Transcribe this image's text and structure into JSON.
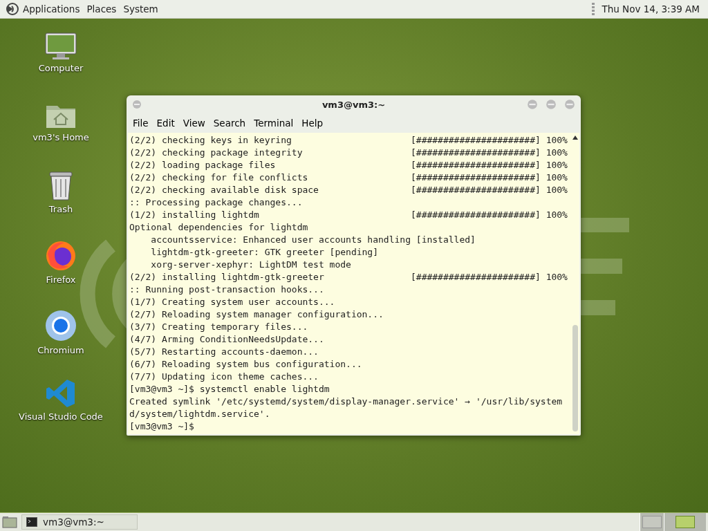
{
  "top_panel": {
    "menus": [
      "Applications",
      "Places",
      "System"
    ],
    "clock": "Thu Nov 14,  3:39 AM"
  },
  "desktop_icons": [
    {
      "kind": "computer",
      "label": "Computer"
    },
    {
      "kind": "home",
      "label": "vm3's Home"
    },
    {
      "kind": "trash",
      "label": "Trash"
    },
    {
      "kind": "firefox",
      "label": "Firefox"
    },
    {
      "kind": "chromium",
      "label": "Chromium"
    },
    {
      "kind": "vscode",
      "label": "Visual Studio Code"
    }
  ],
  "terminal": {
    "title": "vm3@vm3:~",
    "menus": [
      "File",
      "Edit",
      "View",
      "Search",
      "Terminal",
      "Help"
    ],
    "lines": [
      {
        "text": "(2/2) checking keys in keyring",
        "bar": "[######################]",
        "percent": "100%"
      },
      {
        "text": "(2/2) checking package integrity",
        "bar": "[######################]",
        "percent": "100%"
      },
      {
        "text": "(2/2) loading package files",
        "bar": "[######################]",
        "percent": "100%"
      },
      {
        "text": "(2/2) checking for file conflicts",
        "bar": "[######################]",
        "percent": "100%"
      },
      {
        "text": "(2/2) checking available disk space",
        "bar": "[######################]",
        "percent": "100%"
      },
      {
        "text": ":: Processing package changes..."
      },
      {
        "text": "(1/2) installing lightdm",
        "bar": "[######################]",
        "percent": "100%"
      },
      {
        "text": "Optional dependencies for lightdm"
      },
      {
        "text": "    accountsservice: Enhanced user accounts handling [installed]"
      },
      {
        "text": "    lightdm-gtk-greeter: GTK greeter [pending]"
      },
      {
        "text": "    xorg-server-xephyr: LightDM test mode"
      },
      {
        "text": "(2/2) installing lightdm-gtk-greeter",
        "bar": "[######################]",
        "percent": "100%"
      },
      {
        "text": ":: Running post-transaction hooks..."
      },
      {
        "text": "(1/7) Creating system user accounts..."
      },
      {
        "text": "(2/7) Reloading system manager configuration..."
      },
      {
        "text": "(3/7) Creating temporary files..."
      },
      {
        "text": "(4/7) Arming ConditionNeedsUpdate..."
      },
      {
        "text": "(5/7) Restarting accounts-daemon..."
      },
      {
        "text": "(6/7) Reloading system bus configuration..."
      },
      {
        "text": "(7/7) Updating icon theme caches..."
      },
      {
        "text": "[vm3@vm3 ~]$ systemctl enable lightdm"
      },
      {
        "text": "Created symlink '/etc/systemd/system/display-manager.service' → '/usr/lib/system"
      },
      {
        "text": "d/system/lightdm.service'."
      },
      {
        "text": "[vm3@vm3 ~]$"
      }
    ]
  },
  "taskbar": {
    "tasks": [
      {
        "label": "vm3@vm3:~",
        "selected": false
      }
    ],
    "workspaces": [
      {
        "selected": false
      },
      {
        "selected": true
      }
    ]
  }
}
